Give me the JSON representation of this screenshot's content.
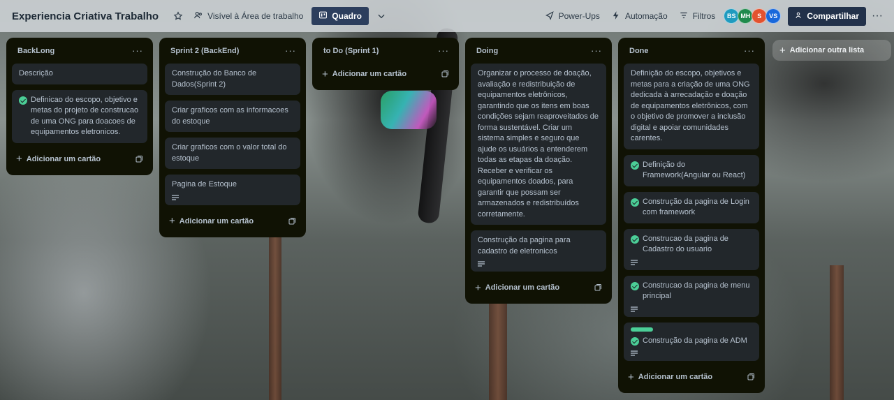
{
  "header": {
    "board_title": "Experiencia Criativa Trabalho",
    "visibility_label": "Visível à Área de trabalho",
    "view_label": "Quadro",
    "powerups_label": "Power-Ups",
    "automation_label": "Automação",
    "filters_label": "Filtros",
    "members": [
      {
        "initials": "BS",
        "color": "#1f9bbf"
      },
      {
        "initials": "MH",
        "color": "#1f8a4c"
      },
      {
        "initials": "S",
        "color": "#e2522f"
      },
      {
        "initials": "VS",
        "color": "#1868db"
      }
    ],
    "share_label": "Compartilhar"
  },
  "add_card_label": "Adicionar um cartão",
  "add_list_label": "Adicionar outra lista",
  "lists": [
    {
      "title": "BackLong",
      "cards": [
        {
          "text": "Descrição",
          "done": false,
          "desc": false
        },
        {
          "text": "Definicao do escopo, objetivo e metas do projeto de construcao de uma ONG para doacoes de equipamentos eletronicos.",
          "done": true,
          "desc": false
        }
      ]
    },
    {
      "title": "Sprint 2 (BackEnd)",
      "cards": [
        {
          "text": "Construção do Banco de Dados(Sprint 2)",
          "done": false,
          "desc": false
        },
        {
          "text": "Criar graficos com as informacoes do estoque",
          "done": false,
          "desc": false
        },
        {
          "text": "Criar graficos com o valor total do estoque",
          "done": false,
          "desc": false
        },
        {
          "text": "Pagina de Estoque",
          "done": false,
          "desc": true
        }
      ]
    },
    {
      "title": "to Do (Sprint 1)",
      "cards": []
    },
    {
      "title": "Doing",
      "cards": [
        {
          "text": "Organizar o processo de doação, avaliação e redistribuição de equipamentos eletrônicos, garantindo que os itens em boas condições sejam reaproveitados de forma sustentável. Criar um sistema simples e seguro que ajude os usuários a entenderem todas as etapas da doação. Receber e verificar os equipamentos doados, para garantir que possam ser armazenados e redistribuídos corretamente.",
          "done": false,
          "desc": false
        },
        {
          "text": "Construção da pagina para cadastro de eletronicos",
          "done": false,
          "desc": true
        }
      ]
    },
    {
      "title": "Done",
      "cards": [
        {
          "text": "Definição do escopo, objetivos e metas para a criação de uma ONG dedicada à arrecadação e doação de equipamentos eletrônicos, com o objetivo de promover a inclusão digital e apoiar comunidades carentes.",
          "done": false,
          "desc": false
        },
        {
          "text": "Definição do Framework(Angular ou React)",
          "done": true,
          "desc": false
        },
        {
          "text": "Construção da pagina de Login com framework",
          "done": true,
          "desc": false
        },
        {
          "text": "Construcao da pagina de Cadastro do usuario",
          "done": true,
          "desc": true
        },
        {
          "text": "Construcao da pagina de menu principal",
          "done": true,
          "desc": true
        },
        {
          "text": "Construção da pagina de ADM",
          "done": true,
          "desc": true,
          "label_color": "#4bce97"
        }
      ]
    }
  ]
}
